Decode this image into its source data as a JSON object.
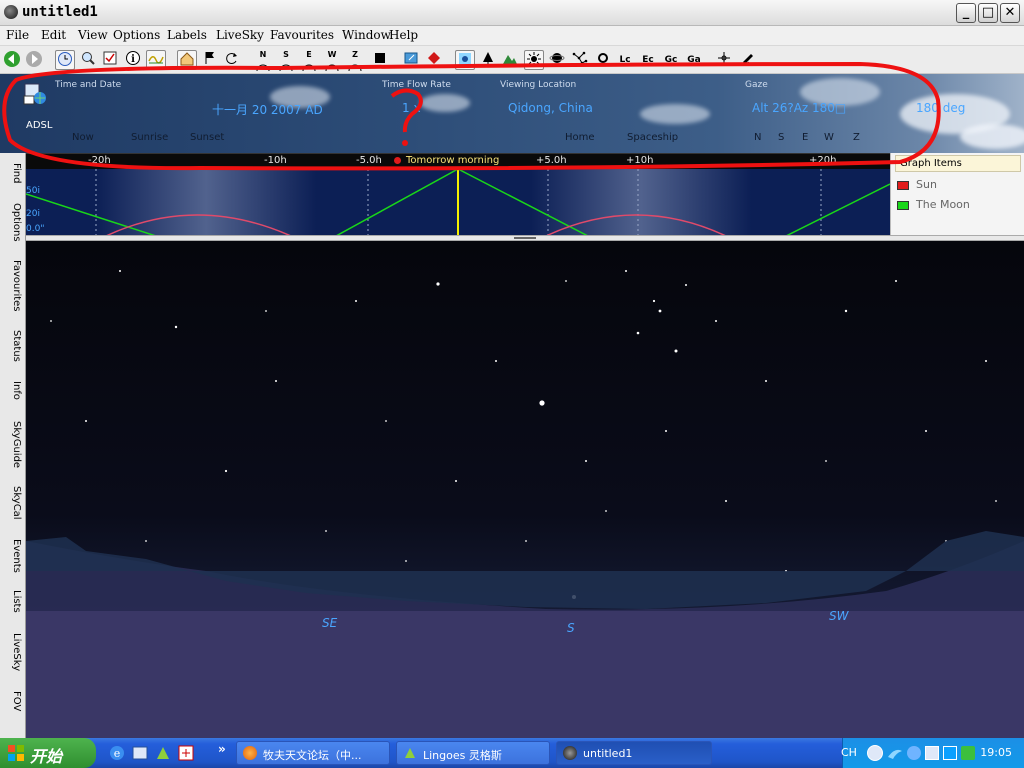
{
  "window": {
    "title": "untitled1",
    "controls": [
      "_",
      "□",
      "✕"
    ]
  },
  "menu": [
    "File",
    "Edit",
    "View",
    "Options",
    "Labels",
    "LiveSky",
    "Favourites",
    "Window",
    "Help"
  ],
  "toolbar": {
    "compass": [
      "N",
      "S",
      "E",
      "W",
      "Z"
    ],
    "right_labels": [
      "Lc",
      "Ec",
      "Gc",
      "Ga"
    ]
  },
  "panel": {
    "network_label": "ADSL",
    "time_date_label": "Time and Date",
    "date_value": "十一月 20   2007 AD",
    "time_flow_label": "Time Flow Rate",
    "time_flow_value": "1 x",
    "viewing_location_label": "Viewing Location",
    "location_value": "Qidong, China",
    "gaze_label": "Gaze",
    "gaze_value": "Alt 26?Az 180□",
    "zoom_value": "180  deg",
    "links": {
      "now": "Now",
      "sunrise": "Sunrise",
      "sunset": "Sunset",
      "home": "Home",
      "spaceship": "Spaceship"
    },
    "gaze_dirs": [
      "N",
      "S",
      "E",
      "W",
      "Z"
    ]
  },
  "timeline": {
    "ticks": [
      "-20h",
      "-10h",
      "-5.0h",
      "+5.0h",
      "+10h",
      "+20h"
    ],
    "marker": "Tomorrow morning"
  },
  "graph": {
    "y_labels": [
      "50i",
      "20i",
      "0.0\""
    ],
    "items_header": "Graph Items",
    "items": [
      {
        "name": "Sun",
        "color": "#e01b1b"
      },
      {
        "name": "The Moon",
        "color": "#19d619"
      }
    ]
  },
  "left_tabs": [
    "Find",
    "Options",
    "Favourites",
    "Status",
    "Info",
    "SkyGuide",
    "SkyCal",
    "Events",
    "Lists",
    "LiveSky",
    "FOV"
  ],
  "sky": {
    "directions": [
      "SE",
      "S",
      "SW"
    ]
  },
  "taskbar": {
    "start": "开始",
    "tasks": [
      {
        "label": "牧夫天文论坛（中..."
      },
      {
        "label": "Lingoes 灵格斯"
      },
      {
        "label": "untitled1"
      }
    ],
    "tray_lang": "CH",
    "clock": "19:05"
  }
}
